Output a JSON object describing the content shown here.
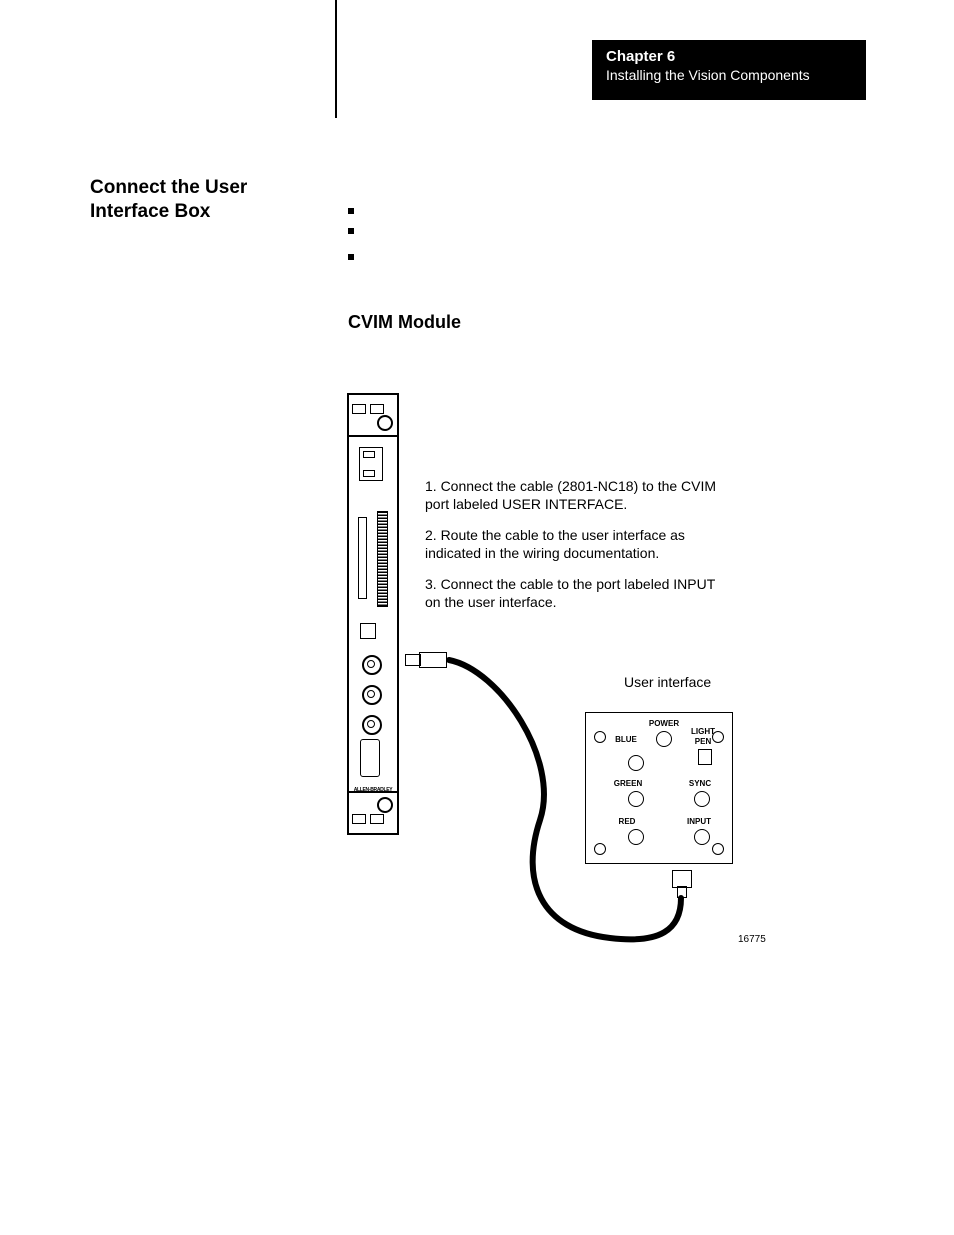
{
  "header": {
    "chapter": "Chapter  6",
    "subtitle": "Installing the Vision Components"
  },
  "side_heading": "Connect the User Interface Box",
  "section_heading": "CVIM Module",
  "steps": {
    "s1": "1.  Connect the cable (2801-NC18) to the CVIM port labeled USER INTERFACE.",
    "s2": "2.  Route the cable to the user interface as indicated in the wiring documentation.",
    "s3": "3.  Connect the cable to the port labeled INPUT on the user interface."
  },
  "ui_label": "User interface",
  "module_brand": "ALLEN-BRADLEY",
  "ui_ports": {
    "power": "POWER",
    "blue": "BLUE",
    "green": "GREEN",
    "red": "RED",
    "lightpen_a": "LIGHT",
    "lightpen_b": "PEN",
    "sync": "SYNC",
    "input": "INPUT"
  },
  "figure_number": "16775"
}
